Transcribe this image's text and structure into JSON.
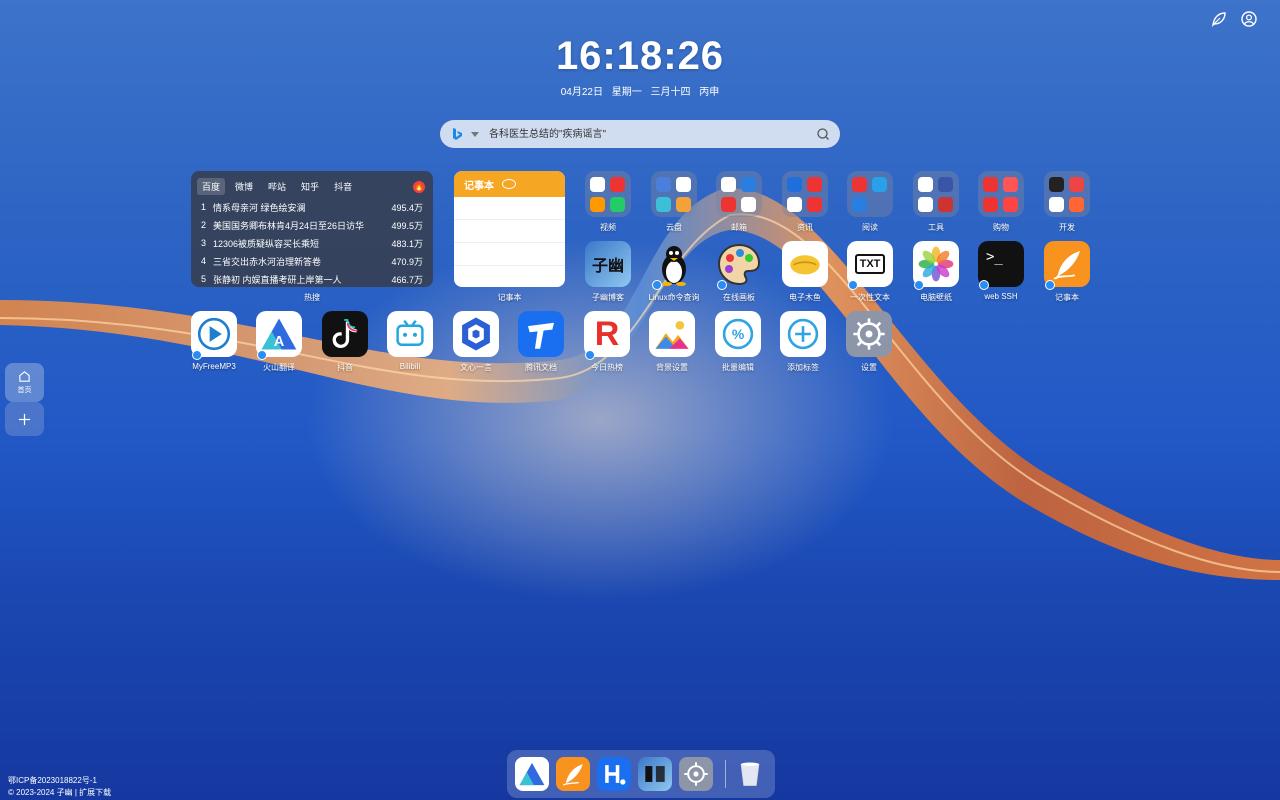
{
  "clock": {
    "time": "16:18:26",
    "date": "04月22日",
    "weekday": "星期一",
    "lunar": "三月十四",
    "ganzhi": "丙申"
  },
  "search": {
    "placeholder": "各科医生总结的\"疾病谣言\""
  },
  "top_icons": [
    "leaf-icon",
    "user-icon"
  ],
  "hot_widget": {
    "tabs": [
      "百度",
      "微博",
      "哔站",
      "知乎",
      "抖音"
    ],
    "items": [
      {
        "rank": "1",
        "title": "情系母亲河 绿色绘安澜",
        "value": "495.4万"
      },
      {
        "rank": "2",
        "title": "美国国务卿布林肯4月24日至26日访华",
        "value": "499.5万"
      },
      {
        "rank": "3",
        "title": "12306被质疑纵容买长乘短",
        "value": "483.1万"
      },
      {
        "rank": "4",
        "title": "三省交出赤水河治理新答卷",
        "value": "470.9万"
      },
      {
        "rank": "5",
        "title": "张静初 内娱直播考研上岸第一人",
        "value": "466.7万"
      }
    ],
    "label": "热搜"
  },
  "note_widget": {
    "header": "记事本",
    "label": "记事本"
  },
  "folders": [
    {
      "label": "视频"
    },
    {
      "label": "云盘"
    },
    {
      "label": "邮箱"
    },
    {
      "label": "资讯"
    },
    {
      "label": "阅读"
    },
    {
      "label": "工具"
    },
    {
      "label": "购物"
    },
    {
      "label": "开发"
    }
  ],
  "row2": [
    {
      "label": "子幽博客",
      "icon_text": "子幽"
    },
    {
      "label": "Linux命令查询"
    },
    {
      "label": "在线画板"
    },
    {
      "label": "电子木鱼"
    },
    {
      "label": "一次性文本",
      "icon_text": "TXT"
    },
    {
      "label": "电脑壁纸"
    },
    {
      "label": "web SSH",
      "icon_text": ">_"
    },
    {
      "label": "记事本"
    }
  ],
  "row3": [
    {
      "label": "MyFreeMP3"
    },
    {
      "label": "火山翻译",
      "icon_text": "A"
    },
    {
      "label": "抖音"
    },
    {
      "label": "Bilibili"
    },
    {
      "label": "文心一言"
    },
    {
      "label": "腾讯文档"
    },
    {
      "label": "今日热榜",
      "icon_text": "R"
    },
    {
      "label": "背景设置"
    },
    {
      "label": "批量编辑",
      "icon_text": "%"
    },
    {
      "label": "添加标签",
      "icon_text": "+"
    },
    {
      "label": "设置"
    }
  ],
  "sidebar": {
    "home": "首页"
  },
  "footer": {
    "icp": "鄂ICP备2023018822号-1",
    "copyright": "© 2023-2024 子幽 | 扩展下载"
  }
}
